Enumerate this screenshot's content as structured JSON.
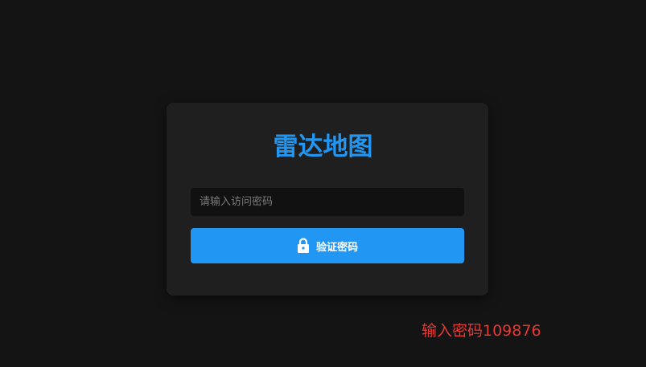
{
  "login": {
    "title": "雷达地图",
    "password_placeholder": "请输入访问密码",
    "password_value": "",
    "verify_button_label": "验证密码",
    "verify_button_icon": "lock-icon"
  },
  "hint_text": "输入密码109876",
  "colors": {
    "background": "#141414",
    "card": "#1f1f1f",
    "accent": "#2196f3",
    "hint": "#e53935"
  }
}
